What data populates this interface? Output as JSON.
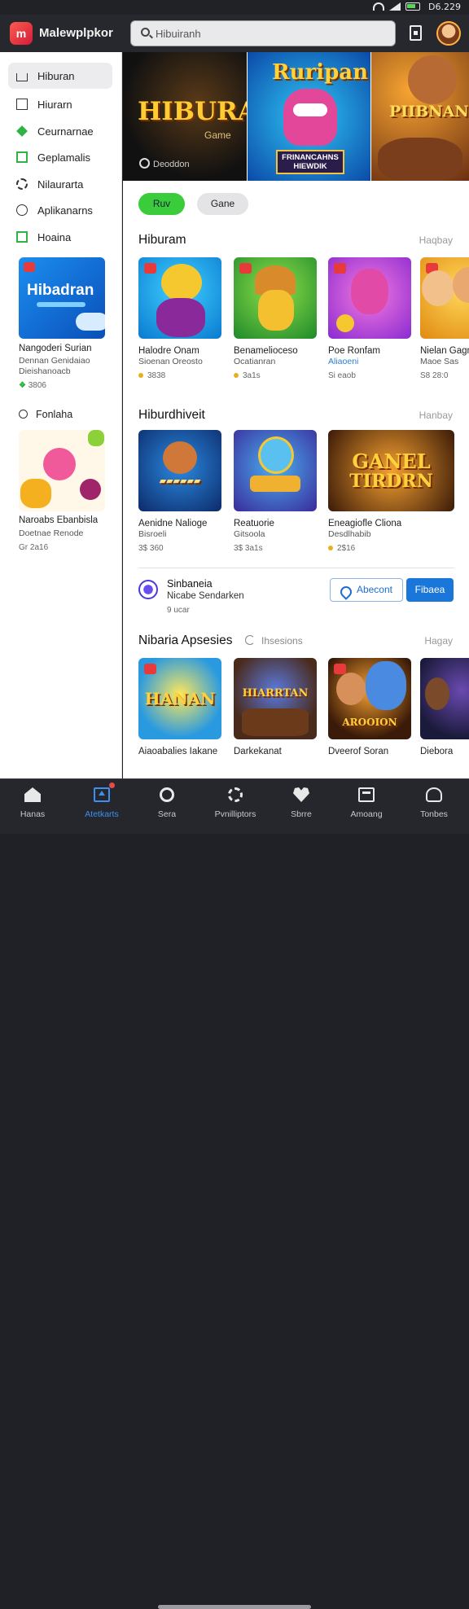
{
  "status": {
    "time": "D6.229"
  },
  "app": {
    "name": "Malewplpkor",
    "logo_text": "m",
    "search": {
      "value": "Hibuiranh",
      "placeholder": "Hibuiranh"
    }
  },
  "sidebar": {
    "items": [
      {
        "label": "Hiburan",
        "icon": "home-icon"
      },
      {
        "label": "Hiurarn",
        "icon": "box-icon"
      },
      {
        "label": "Ceurnarnae",
        "icon": "diamond-icon"
      },
      {
        "label": "Geplamalis",
        "icon": "square-icon"
      },
      {
        "label": "Nilaurarta",
        "icon": "gear-icon"
      },
      {
        "label": "Aplikanarns",
        "icon": "circle-icon"
      },
      {
        "label": "Hoaina",
        "icon": "square-icon"
      }
    ],
    "promo_card": {
      "image_text": "Hibadran",
      "title": "Nangoderi Surian",
      "sub1": "Dennan Genidaiao",
      "sub2": "Dieishanoacb",
      "meta_value": "3806"
    },
    "section2_label": "Fonlaha",
    "promo_card2": {
      "title": "Naroabs Ebanbisla",
      "sub1": "Doetnae Renode",
      "meta": "Gr 2a16"
    }
  },
  "banner": [
    {
      "title": "HIBURAI",
      "subtitle": "Game",
      "developer": "Deoddon"
    },
    {
      "title": "Ruripan",
      "subtitle": "FRINANCAHNS HIEWDIK"
    },
    {
      "title": "PIIBNANES"
    }
  ],
  "chips": [
    "Ruv",
    "Gane"
  ],
  "sections": [
    {
      "title": "Hiburam",
      "more": "Haqbay",
      "cards": [
        {
          "title": "Halodre Onam",
          "sub": "Sioenan Oreosto",
          "meta": "3838",
          "dot": true
        },
        {
          "title": "Benamelioceso",
          "sub": "Ocatianran",
          "meta": "3a1s",
          "dot": true
        },
        {
          "title": "Poe Ronfam",
          "sub": "Aliaoeni",
          "meta": "Si eaob",
          "dot": false,
          "blue": true
        },
        {
          "title": "Nielan Gagn",
          "sub": "Maoe Sas",
          "meta": "S8 28:0",
          "dot": false
        }
      ]
    },
    {
      "title": "Hiburdhiveit",
      "more": "Hanbay",
      "cards": [
        {
          "title": "Aenidne Nalioge",
          "sub": "Bisroeli",
          "meta": "3$ 360",
          "dot": false
        },
        {
          "title": "Reatuorie",
          "sub": "Gitsoola",
          "meta": "3$ 3a1s",
          "dot": false
        },
        {
          "title": "Eneagiofle Cliona",
          "sub": "Desdlhabib",
          "meta": "2$16",
          "dot": true
        }
      ]
    }
  ],
  "promo_row": {
    "title": "Sinbaneia",
    "subtitle": "Nicabe Sendarken",
    "meta": "9 ucar",
    "outline_button": "Abecont",
    "fill_button": "Fibaea"
  },
  "section3": {
    "title": "Nibaria Apsesies",
    "sub": "Ihsesions",
    "more": "Hagay",
    "cards": [
      {
        "title": "Aiaoabalies Iakane",
        "image_text": "HANAN"
      },
      {
        "title": "Darkekanat",
        "image_text": "HIARRTAN"
      },
      {
        "title": "Dveerof Soran",
        "image_text": "AROOION"
      },
      {
        "title": "Diebora"
      }
    ]
  },
  "bottom_nav": [
    {
      "label": "Hanas",
      "icon": "home-icon",
      "active": false
    },
    {
      "label": "Atetkarts",
      "icon": "apps-icon",
      "active": true
    },
    {
      "label": "Sera",
      "icon": "search-icon",
      "active": false
    },
    {
      "label": "Pvnilliptors",
      "icon": "gear-icon",
      "active": false
    },
    {
      "label": "Sbrre",
      "icon": "heart-icon",
      "active": false
    },
    {
      "label": "Amoang",
      "icon": "library-icon",
      "active": false
    },
    {
      "label": "Tonbes",
      "icon": "user-icon",
      "active": false
    }
  ],
  "colors": {
    "accent": "#1b76d9",
    "chip_active": "#3bcc3b",
    "nav_active": "#3d8ff0"
  }
}
